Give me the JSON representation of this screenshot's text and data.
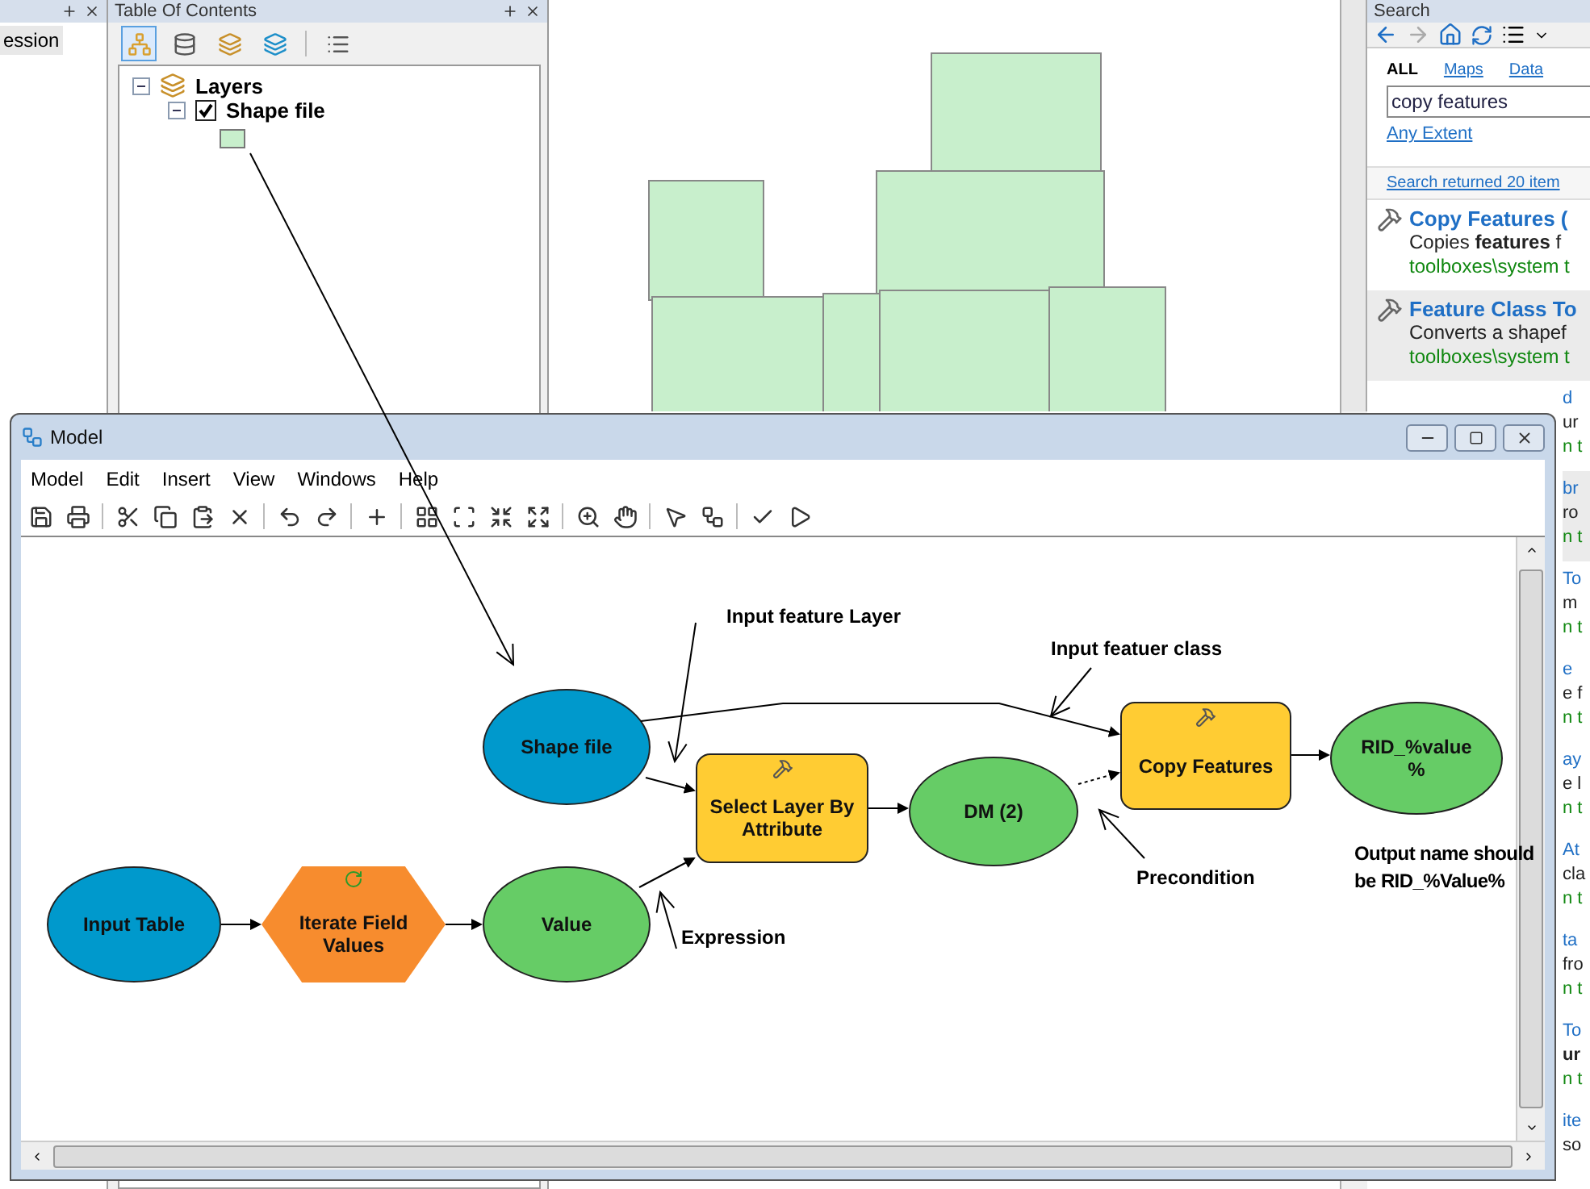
{
  "left_panel": {
    "item": "ession"
  },
  "toc": {
    "title": "Table Of Contents",
    "tree": [
      {
        "label": "Layers",
        "expanded": true,
        "children": [
          {
            "label": "Shape file",
            "checked": true,
            "expanded": true
          }
        ]
      }
    ]
  },
  "search": {
    "title": "Search",
    "tabs": [
      {
        "label": "ALL",
        "selected": true
      },
      {
        "label": "Maps",
        "selected": false
      },
      {
        "label": "Data",
        "selected": false
      }
    ],
    "query": "copy features",
    "extent": "Any Extent",
    "summary": "Search returned 20 item",
    "results": [
      {
        "kind": "full",
        "title": "Copy Features (",
        "description": "Copies **features** f",
        "path": "toolboxes\\system t",
        "selected": false
      },
      {
        "kind": "full",
        "title": "Feature Class To",
        "description": "Converts a shapef",
        "path": "toolboxes\\system t",
        "selected": true
      },
      {
        "kind": "partial",
        "title": "d",
        "description": "ur",
        "path": "n t",
        "selected": false
      },
      {
        "kind": "partial",
        "title": "br",
        "description": "ro",
        "path": "n t",
        "selected": true
      },
      {
        "kind": "partial",
        "title": "To",
        "description": "m",
        "path": "n t",
        "selected": false
      },
      {
        "kind": "partial",
        "title": "e",
        "description": "e f",
        "path": "n t",
        "selected": false
      },
      {
        "kind": "partial",
        "title": "ay",
        "description": "e l",
        "path": "n t",
        "selected": false
      },
      {
        "kind": "partial",
        "title": "At",
        "description": "cla",
        "path": "n t",
        "selected": false
      },
      {
        "kind": "partial",
        "title": "ta",
        "description": "fro",
        "path": "n t",
        "selected": false
      },
      {
        "kind": "partial",
        "title": "To",
        "description": "**ur**",
        "path": "n t",
        "selected": false
      },
      {
        "kind": "partial",
        "title": "ite",
        "description": "so",
        "selected": false
      }
    ]
  },
  "model": {
    "title": "Model",
    "menu": [
      "Model",
      "Edit",
      "Insert",
      "View",
      "Windows",
      "Help"
    ],
    "nodes": [
      {
        "label": "Input Table",
        "kind": "ellipse",
        "color": "#0099cc"
      },
      {
        "label": "Iterate Field Values",
        "kind": "hexagon",
        "color": "#f78c2e"
      },
      {
        "label": "Value",
        "kind": "ellipse",
        "color": "#66cc66"
      },
      {
        "label": "Shape file",
        "kind": "ellipse",
        "color": "#0099cc"
      },
      {
        "label": "Select Layer By Attribute",
        "kind": "tool",
        "color": "#ffcc33"
      },
      {
        "label": "DM (2)",
        "kind": "ellipse",
        "color": "#66cc66"
      },
      {
        "label": "Copy Features",
        "kind": "tool",
        "color": "#ffcc33"
      },
      {
        "label": "RID_%value %",
        "kind": "ellipse",
        "color": "#66cc66"
      }
    ],
    "notes": [
      "Input feature  Layer",
      "Input featuer class",
      "Precondition",
      "Expression",
      "Output name should be RID_%Value%"
    ]
  }
}
